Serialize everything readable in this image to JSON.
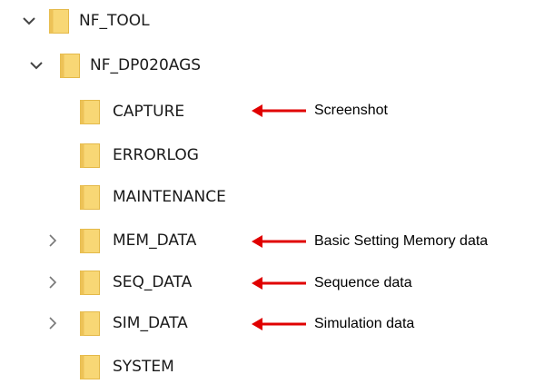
{
  "tree": {
    "root": {
      "label": "NF_TOOL",
      "icon": "folder-icon",
      "chevron": "chevron-down-icon"
    },
    "child": {
      "label": "NF_DP020AGS",
      "icon": "folder-icon",
      "chevron": "chevron-down-icon"
    },
    "items": [
      {
        "label": "CAPTURE",
        "icon": "folder-icon"
      },
      {
        "label": "ERRORLOG",
        "icon": "folder-icon"
      },
      {
        "label": "MAINTENANCE",
        "icon": "folder-icon"
      },
      {
        "label": "MEM_DATA",
        "icon": "folder-icon",
        "chevron": "chevron-right-icon"
      },
      {
        "label": "SEQ_DATA",
        "icon": "folder-icon",
        "chevron": "chevron-right-icon"
      },
      {
        "label": "SIM_DATA",
        "icon": "folder-icon",
        "chevron": "chevron-right-icon"
      },
      {
        "label": "SYSTEM",
        "icon": "folder-icon"
      }
    ]
  },
  "annotations": [
    {
      "text": "Screenshot",
      "target": "CAPTURE"
    },
    {
      "text": "Basic Setting Memory data",
      "target": "MEM_DATA"
    },
    {
      "text": "Sequence data",
      "target": "SEQ_DATA"
    },
    {
      "text": "Simulation data",
      "target": "SIM_DATA"
    }
  ],
  "colors": {
    "folder_fill": "#F8D775",
    "folder_edge": "#E4B94A",
    "chevron": "#555555",
    "arrow": "#E00000",
    "text": "#1a1a1a"
  }
}
